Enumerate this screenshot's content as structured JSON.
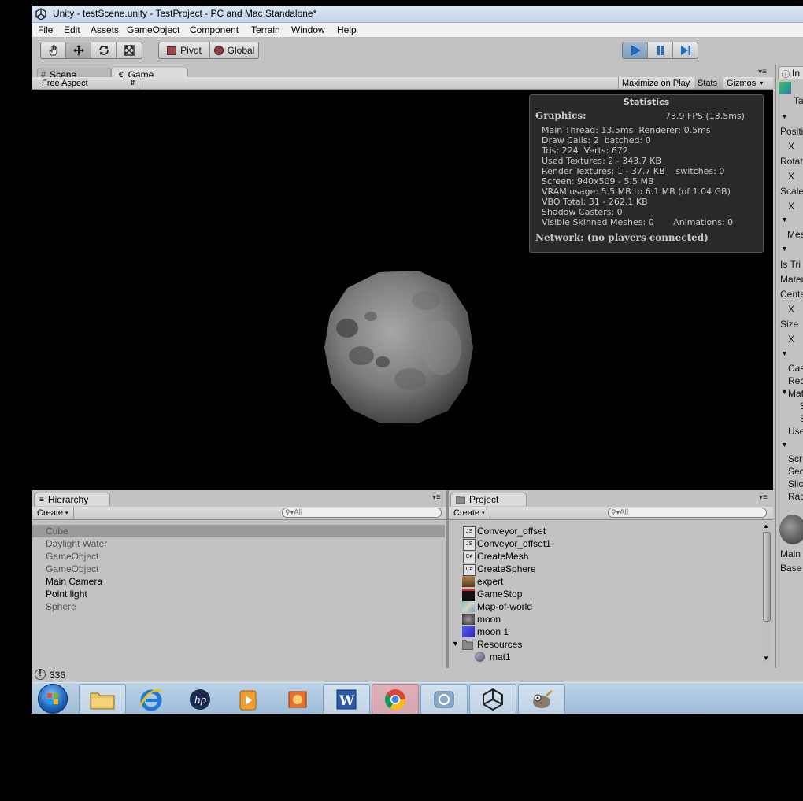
{
  "window": {
    "title": "Unity - testScene.unity - TestProject - PC and Mac Standalone*"
  },
  "menu": {
    "items": [
      "File",
      "Edit",
      "Assets",
      "GameObject",
      "Component",
      "Terrain",
      "Window",
      "Help"
    ]
  },
  "toolbar": {
    "tools": [
      "hand-icon",
      "move-icon",
      "rotate-icon",
      "scale-icon"
    ],
    "pivot_label": "Pivot",
    "global_label": "Global",
    "play_icon": "play-icon",
    "pause_icon": "pause-icon",
    "step_icon": "step-icon"
  },
  "view_tabs": {
    "scene": "Scene",
    "game": "Game"
  },
  "game_bar": {
    "aspect": "Free Aspect",
    "maximize": "Maximize on Play",
    "stats": "Stats",
    "gizmos": "Gizmos"
  },
  "stats": {
    "heading": "Statistics",
    "graphics_label": "Graphics:",
    "fps": "73.9 FPS (13.5ms)",
    "lines": [
      "Main Thread: 13.5ms  Renderer: 0.5ms",
      "Draw Calls: 2  batched: 0",
      "Tris: 224  Verts: 672",
      "Used Textures: 2 - 343.7 KB",
      "Render Textures: 1 - 37.7 KB    switches: 0",
      "Screen: 940x509 - 5.5 MB",
      "VRAM usage: 5.5 MB to 6.1 MB (of 1.04 GB)",
      "VBO Total: 31 - 262.1 KB",
      "Shadow Casters: 0",
      "Visible Skinned Meshes: 0       Animations: 0"
    ],
    "network": "Network: (no players connected)"
  },
  "hierarchy": {
    "tab": "Hierarchy",
    "create": "Create",
    "search_placeholder": "All",
    "items": [
      {
        "label": "Cube",
        "selected": true,
        "color": "#5a5a5a"
      },
      {
        "label": "Daylight Water",
        "selected": false,
        "color": "#555555"
      },
      {
        "label": "GameObject",
        "selected": false,
        "color": "#555555"
      },
      {
        "label": "GameObject",
        "selected": false,
        "color": "#555555"
      },
      {
        "label": "Main Camera",
        "selected": false,
        "color": "#000000"
      },
      {
        "label": "Point light",
        "selected": false,
        "color": "#000000"
      },
      {
        "label": "Sphere",
        "selected": false,
        "color": "#555555"
      }
    ]
  },
  "project": {
    "tab": "Project",
    "create": "Create",
    "search_placeholder": "All",
    "items": [
      {
        "label": "Conveyor_offset",
        "icon": "script-icon"
      },
      {
        "label": "Conveyor_offset1",
        "icon": "script-icon"
      },
      {
        "label": "CreateMesh",
        "icon": "csharp-script-icon"
      },
      {
        "label": "CreateSphere",
        "icon": "csharp-script-icon"
      },
      {
        "label": "expert",
        "icon": "texture-icon"
      },
      {
        "label": "GameStop",
        "icon": "texture-icon"
      },
      {
        "label": "Map-of-world",
        "icon": "texture-icon"
      },
      {
        "label": "moon",
        "icon": "texture-icon"
      },
      {
        "label": "moon 1",
        "icon": "material-icon"
      },
      {
        "label": "Resources",
        "icon": "folder-icon"
      },
      {
        "label": "mat1",
        "icon": "sphere-material-icon"
      }
    ]
  },
  "inspector": {
    "tab": "In",
    "labels": [
      "Ta",
      "Positi",
      "X",
      "Rotat",
      "X",
      "Scale",
      "X",
      "Mes",
      "Is Tri",
      "Mater",
      "Cente",
      "X",
      "Size",
      "X",
      "Cas",
      "Rec",
      "Mat",
      "S",
      "E",
      "Use",
      "Scr",
      "Sec",
      "Slic",
      "Rad",
      "Main",
      "Base"
    ]
  },
  "status": {
    "text": "336"
  },
  "taskbar": {
    "items": [
      "start-orb",
      "explorer-icon",
      "ie-icon",
      "hp-icon",
      "media-player-icon",
      "photo-icon",
      "word-icon",
      "chrome-icon",
      "network-icon",
      "unity-icon",
      "gimp-icon"
    ]
  }
}
